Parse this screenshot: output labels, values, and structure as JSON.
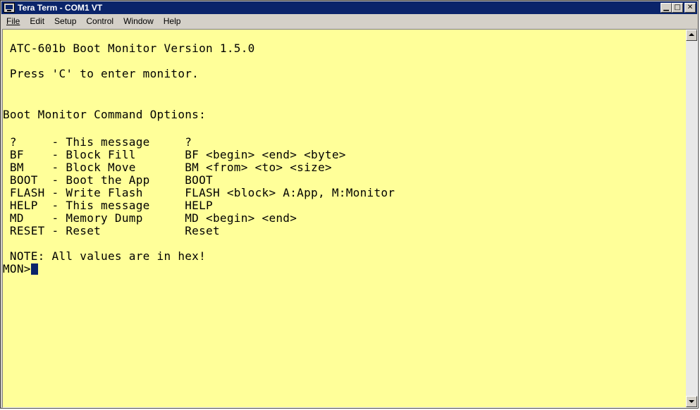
{
  "window": {
    "title": "Tera Term - COM1 VT",
    "menu": [
      {
        "label": "File"
      },
      {
        "label": "Edit"
      },
      {
        "label": "Setup"
      },
      {
        "label": "Control"
      },
      {
        "label": "Window"
      },
      {
        "label": "Help"
      }
    ]
  },
  "terminal": {
    "lines": [
      " ATC-601b Boot Monitor Version 1.5.0",
      " Press 'C' to enter monitor.",
      "Boot Monitor Command Options:",
      " ?     - This message     ?",
      " BF    - Block Fill       BF <begin> <end> <byte>",
      " BM    - Block Move       BM <from> <to> <size>",
      " BOOT  - Boot the App     BOOT",
      " FLASH - Write Flash      FLASH <block> A:App, M:Monitor",
      " HELP  - This message     HELP",
      " MD    - Memory Dump      MD <begin> <end>",
      " RESET - Reset            Reset",
      " NOTE: All values are in hex!",
      "MON>"
    ]
  },
  "icons": {
    "app": "tera-term-icon",
    "minimize": "minimize-icon",
    "maximize": "maximize-icon",
    "close": "close-icon",
    "scroll_up": "arrow-up-icon",
    "scroll_down": "arrow-down-icon"
  },
  "colors": {
    "terminal_bg": "#ffff99",
    "titlebar": "#0a246a",
    "cursor": "#0a246a"
  }
}
